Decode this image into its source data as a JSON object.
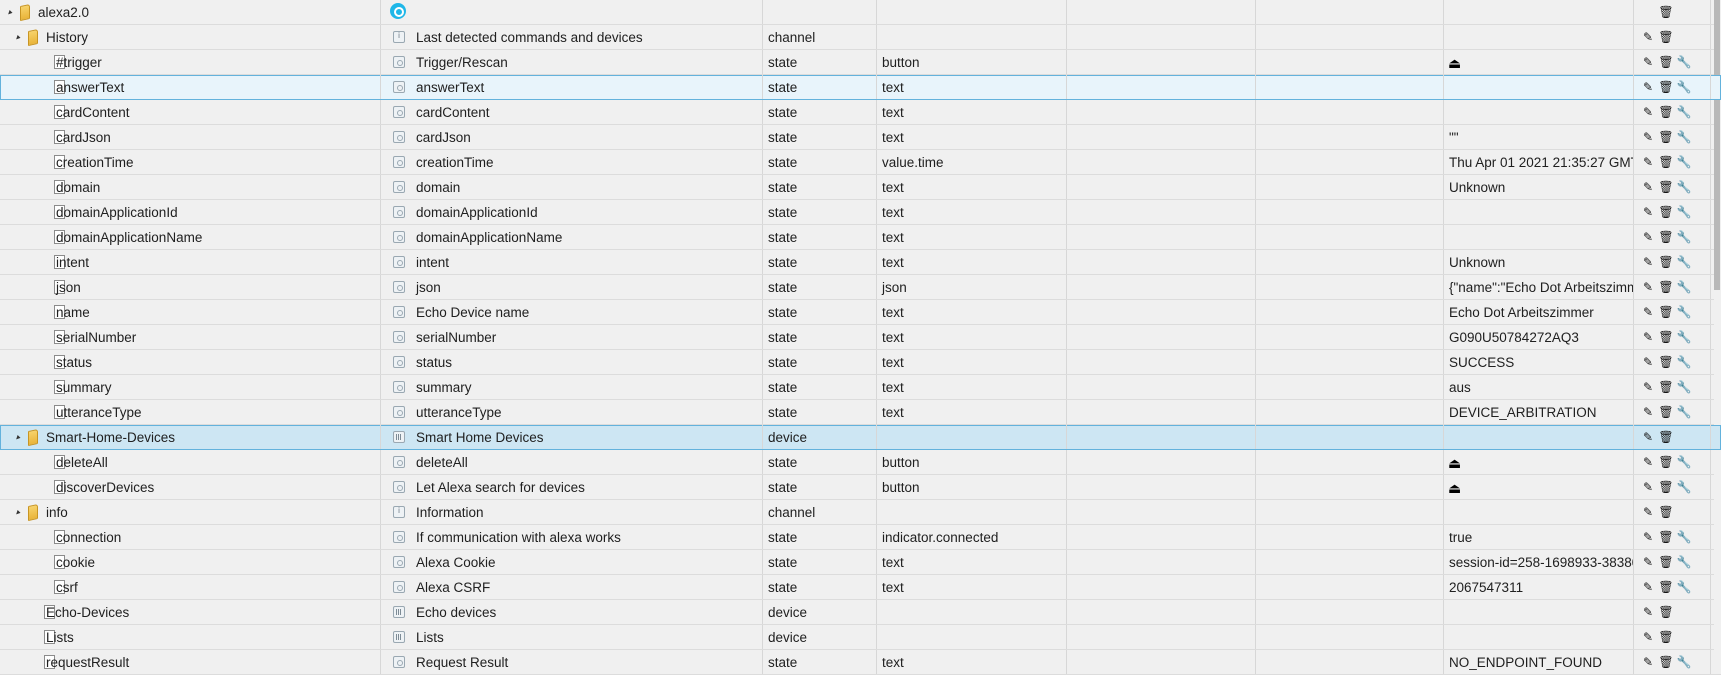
{
  "rows": [
    {
      "depth": 0,
      "kind": "folder",
      "expanded": true,
      "id": "alexa2.0",
      "name_icon": "alexa-logo",
      "name": "",
      "type": "",
      "role": "",
      "value": "",
      "buttons": [
        "del"
      ],
      "highlight": ""
    },
    {
      "depth": 1,
      "kind": "folder",
      "expanded": true,
      "id": "History",
      "name_icon": "channel",
      "name": "Last detected commands and devices",
      "type": "channel",
      "role": "",
      "value": "",
      "buttons": [
        "edit",
        "del"
      ],
      "highlight": ""
    },
    {
      "depth": 2,
      "kind": "file",
      "id": "#trigger",
      "name_icon": "state",
      "name": "Trigger/Rescan",
      "type": "state",
      "role": "button",
      "value": "",
      "value_icon": "trigger",
      "buttons": [
        "edit",
        "del",
        "set"
      ],
      "highlight": ""
    },
    {
      "depth": 2,
      "kind": "file",
      "id": "answerText",
      "name_icon": "state",
      "name": "answerText",
      "type": "state",
      "role": "text",
      "value": "",
      "buttons": [
        "edit",
        "del",
        "set"
      ],
      "highlight": "select"
    },
    {
      "depth": 2,
      "kind": "file",
      "id": "cardContent",
      "name_icon": "state",
      "name": "cardContent",
      "type": "state",
      "role": "text",
      "value": "",
      "buttons": [
        "edit",
        "del",
        "set"
      ],
      "highlight": ""
    },
    {
      "depth": 2,
      "kind": "file",
      "id": "cardJson",
      "name_icon": "state",
      "name": "cardJson",
      "type": "state",
      "role": "text",
      "value": "\"\"",
      "buttons": [
        "edit",
        "del",
        "set"
      ],
      "highlight": ""
    },
    {
      "depth": 2,
      "kind": "file",
      "id": "creationTime",
      "name_icon": "state",
      "name": "creationTime",
      "type": "state",
      "role": "value.time",
      "value": "Thu Apr 01 2021 21:35:27 GMT+",
      "buttons": [
        "edit",
        "del",
        "set"
      ],
      "highlight": ""
    },
    {
      "depth": 2,
      "kind": "file",
      "id": "domain",
      "name_icon": "state",
      "name": "domain",
      "type": "state",
      "role": "text",
      "value": "Unknown",
      "buttons": [
        "edit",
        "del",
        "set"
      ],
      "highlight": ""
    },
    {
      "depth": 2,
      "kind": "file",
      "id": "domainApplicationId",
      "name_icon": "state",
      "name": "domainApplicationId",
      "type": "state",
      "role": "text",
      "value": "",
      "buttons": [
        "edit",
        "del",
        "set"
      ],
      "highlight": ""
    },
    {
      "depth": 2,
      "kind": "file",
      "id": "domainApplicationName",
      "name_icon": "state",
      "name": "domainApplicationName",
      "type": "state",
      "role": "text",
      "value": "",
      "buttons": [
        "edit",
        "del",
        "set"
      ],
      "highlight": ""
    },
    {
      "depth": 2,
      "kind": "file",
      "id": "intent",
      "name_icon": "state",
      "name": "intent",
      "type": "state",
      "role": "text",
      "value": "Unknown",
      "buttons": [
        "edit",
        "del",
        "set"
      ],
      "highlight": ""
    },
    {
      "depth": 2,
      "kind": "file",
      "id": "json",
      "name_icon": "state",
      "name": "json",
      "type": "state",
      "role": "json",
      "value": "{\"name\":\"Echo Dot Arbeitszimm",
      "buttons": [
        "edit",
        "del",
        "set"
      ],
      "highlight": ""
    },
    {
      "depth": 2,
      "kind": "file",
      "id": "name",
      "name_icon": "state",
      "name": "Echo Device name",
      "type": "state",
      "role": "text",
      "value": "Echo Dot Arbeitszimmer",
      "buttons": [
        "edit",
        "del",
        "set"
      ],
      "highlight": ""
    },
    {
      "depth": 2,
      "kind": "file",
      "id": "serialNumber",
      "name_icon": "state",
      "name": "serialNumber",
      "type": "state",
      "role": "text",
      "value": "G090U50784272AQ3",
      "buttons": [
        "edit",
        "del",
        "set"
      ],
      "highlight": ""
    },
    {
      "depth": 2,
      "kind": "file",
      "id": "status",
      "name_icon": "state",
      "name": "status",
      "type": "state",
      "role": "text",
      "value": "SUCCESS",
      "buttons": [
        "edit",
        "del",
        "set"
      ],
      "highlight": ""
    },
    {
      "depth": 2,
      "kind": "file",
      "id": "summary",
      "name_icon": "state",
      "name": "summary",
      "type": "state",
      "role": "text",
      "value": "aus",
      "buttons": [
        "edit",
        "del",
        "set"
      ],
      "highlight": ""
    },
    {
      "depth": 2,
      "kind": "file",
      "id": "utteranceType",
      "name_icon": "state",
      "name": "utteranceType",
      "type": "state",
      "role": "text",
      "value": "DEVICE_ARBITRATION",
      "buttons": [
        "edit",
        "del",
        "set"
      ],
      "highlight": ""
    },
    {
      "depth": 1,
      "kind": "folder",
      "expanded": true,
      "id": "Smart-Home-Devices",
      "name_icon": "device",
      "name": "Smart Home Devices",
      "type": "device",
      "role": "",
      "value": "",
      "buttons": [
        "edit",
        "del"
      ],
      "highlight": "folder"
    },
    {
      "depth": 2,
      "kind": "file",
      "id": "deleteAll",
      "name_icon": "state",
      "name": "deleteAll",
      "type": "state",
      "role": "button",
      "value": "",
      "value_icon": "trigger",
      "buttons": [
        "edit",
        "del",
        "set"
      ],
      "highlight": ""
    },
    {
      "depth": 2,
      "kind": "file",
      "id": "discoverDevices",
      "name_icon": "state",
      "name": "Let Alexa search for devices",
      "type": "state",
      "role": "button",
      "value": "",
      "value_icon": "trigger",
      "buttons": [
        "edit",
        "del",
        "set"
      ],
      "highlight": ""
    },
    {
      "depth": 1,
      "kind": "folder",
      "expanded": true,
      "id": "info",
      "name_icon": "channel",
      "name": "Information",
      "type": "channel",
      "role": "",
      "value": "",
      "buttons": [
        "edit",
        "del"
      ],
      "highlight": ""
    },
    {
      "depth": 2,
      "kind": "file",
      "id": "connection",
      "name_icon": "state",
      "name": "If communication with alexa works",
      "type": "state",
      "role": "indicator.connected",
      "value": "true",
      "buttons": [
        "edit",
        "del",
        "set"
      ],
      "highlight": ""
    },
    {
      "depth": 2,
      "kind": "file",
      "id": "cookie",
      "name_icon": "state",
      "name": "Alexa Cookie",
      "type": "state",
      "role": "text",
      "value": "session-id=258-1698933-38380",
      "buttons": [
        "edit",
        "del",
        "set"
      ],
      "highlight": ""
    },
    {
      "depth": 2,
      "kind": "file",
      "id": "csrf",
      "name_icon": "state",
      "name": "Alexa CSRF",
      "type": "state",
      "role": "text",
      "value": "2067547311",
      "buttons": [
        "edit",
        "del",
        "set"
      ],
      "highlight": ""
    },
    {
      "depth": 1,
      "kind": "file",
      "id": "Echo-Devices",
      "name_icon": "device",
      "name": "Echo devices",
      "type": "device",
      "role": "",
      "value": "",
      "buttons": [
        "edit",
        "del"
      ],
      "highlight": ""
    },
    {
      "depth": 1,
      "kind": "file",
      "id": "Lists",
      "name_icon": "device",
      "name": "Lists",
      "type": "device",
      "role": "",
      "value": "",
      "buttons": [
        "edit",
        "del"
      ],
      "highlight": ""
    },
    {
      "depth": 1,
      "kind": "file",
      "id": "requestResult",
      "name_icon": "state",
      "name": "Request Result",
      "type": "state",
      "role": "text",
      "value": "NO_ENDPOINT_FOUND",
      "buttons": [
        "edit",
        "del",
        "set"
      ],
      "highlight": ""
    }
  ],
  "icons": {
    "toggle": "▲",
    "edit": "✎",
    "del": "🗑",
    "set": "🔧",
    "trigger": "⏏"
  }
}
